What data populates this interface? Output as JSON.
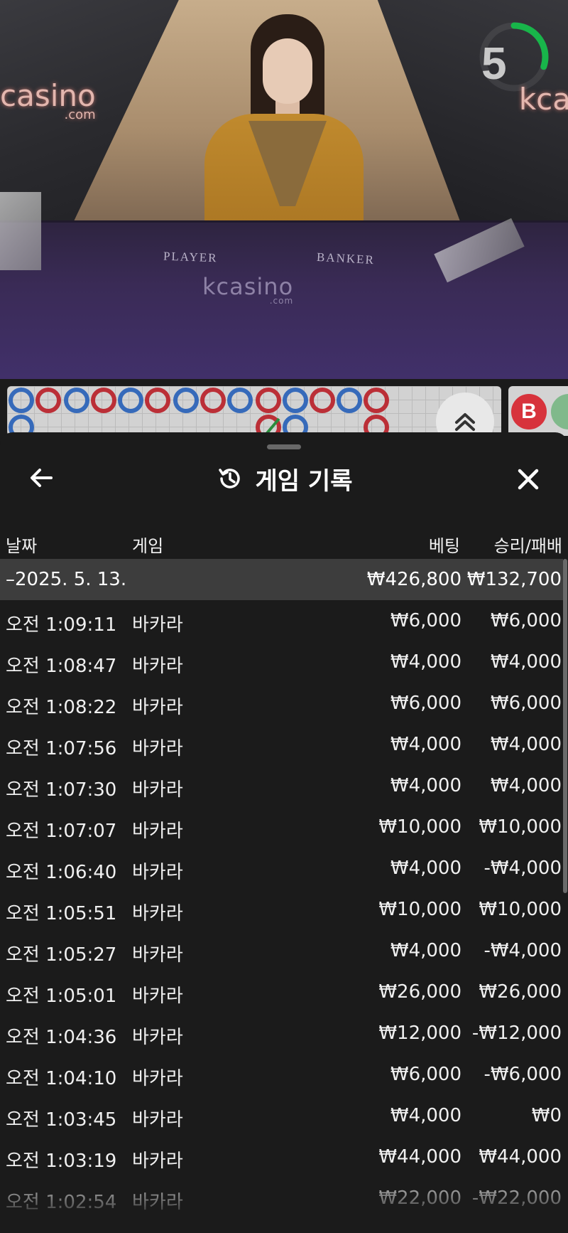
{
  "video": {
    "brand_left": "casino",
    "brand_left_sub": ".com",
    "brand_right": "kca",
    "table_player_label": "PLAYER",
    "table_banker_label": "BANKER",
    "table_logo": "kcasino",
    "table_logo_sub": ".com",
    "countdown": "5",
    "countdown_progress": 0.3
  },
  "road": {
    "scroll_up_icon": "chevrons-up-icon",
    "mini_marker": "B",
    "colors": {
      "player": "#3b78d6",
      "banker": "#d7333c",
      "tie": "#2ea043"
    }
  },
  "sheet": {
    "title": "게임 기록",
    "title_icon": "history-icon",
    "back_icon": "arrow-left-icon",
    "close_icon": "close-icon",
    "columns": {
      "date": "날짜",
      "game": "게임",
      "bet": "베팅",
      "win_loss": "승리/패배"
    },
    "summary": {
      "date": "–2025. 5. 13.",
      "bet": "₩426,800",
      "win_loss": "₩132,700"
    },
    "rows": [
      {
        "time": "오전 1:09:11",
        "game": "바카라",
        "bet": "₩6,000",
        "win_loss": "₩6,000"
      },
      {
        "time": "오전 1:08:47",
        "game": "바카라",
        "bet": "₩4,000",
        "win_loss": "₩4,000"
      },
      {
        "time": "오전 1:08:22",
        "game": "바카라",
        "bet": "₩6,000",
        "win_loss": "₩6,000"
      },
      {
        "time": "오전 1:07:56",
        "game": "바카라",
        "bet": "₩4,000",
        "win_loss": "₩4,000"
      },
      {
        "time": "오전 1:07:30",
        "game": "바카라",
        "bet": "₩4,000",
        "win_loss": "₩4,000"
      },
      {
        "time": "오전 1:07:07",
        "game": "바카라",
        "bet": "₩10,000",
        "win_loss": "₩10,000"
      },
      {
        "time": "오전 1:06:40",
        "game": "바카라",
        "bet": "₩4,000",
        "win_loss": "-₩4,000"
      },
      {
        "time": "오전 1:05:51",
        "game": "바카라",
        "bet": "₩10,000",
        "win_loss": "₩10,000"
      },
      {
        "time": "오전 1:05:27",
        "game": "바카라",
        "bet": "₩4,000",
        "win_loss": "-₩4,000"
      },
      {
        "time": "오전 1:05:01",
        "game": "바카라",
        "bet": "₩26,000",
        "win_loss": "₩26,000"
      },
      {
        "time": "오전 1:04:36",
        "game": "바카라",
        "bet": "₩12,000",
        "win_loss": "-₩12,000"
      },
      {
        "time": "오전 1:04:10",
        "game": "바카라",
        "bet": "₩6,000",
        "win_loss": "-₩6,000"
      },
      {
        "time": "오전 1:03:45",
        "game": "바카라",
        "bet": "₩4,000",
        "win_loss": "₩0"
      },
      {
        "time": "오전 1:03:19",
        "game": "바카라",
        "bet": "₩44,000",
        "win_loss": "₩44,000"
      },
      {
        "time": "오전 1:02:54",
        "game": "바카라",
        "bet": "₩22,000",
        "win_loss": "-₩22,000"
      }
    ]
  }
}
